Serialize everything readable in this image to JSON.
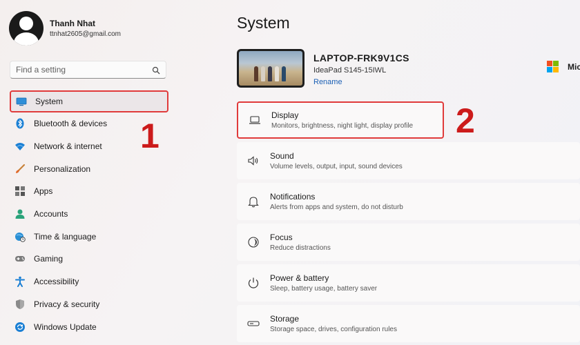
{
  "profile": {
    "name": "Thanh Nhat",
    "email": "ttnhat2605@gmail.com"
  },
  "search": {
    "placeholder": "Find a setting",
    "icon": "search-icon"
  },
  "sidebar": {
    "items": [
      {
        "label": "System",
        "icon": "system-icon",
        "active": true
      },
      {
        "label": "Bluetooth & devices",
        "icon": "bluetooth-icon"
      },
      {
        "label": "Network & internet",
        "icon": "wifi-icon"
      },
      {
        "label": "Personalization",
        "icon": "brush-icon"
      },
      {
        "label": "Apps",
        "icon": "apps-icon"
      },
      {
        "label": "Accounts",
        "icon": "accounts-icon"
      },
      {
        "label": "Time & language",
        "icon": "globe-clock-icon"
      },
      {
        "label": "Gaming",
        "icon": "gamepad-icon"
      },
      {
        "label": "Accessibility",
        "icon": "accessibility-icon"
      },
      {
        "label": "Privacy & security",
        "icon": "shield-icon"
      },
      {
        "label": "Windows Update",
        "icon": "update-icon"
      }
    ]
  },
  "annotations": {
    "step1": "1",
    "step2": "2",
    "color": "#cc1b1b"
  },
  "main": {
    "title": "System",
    "device": {
      "name": "LAPTOP-FRK9V1CS",
      "model": "IdeaPad S145-15IWL",
      "rename_label": "Rename"
    },
    "microsoft_label": "Mic",
    "cards": [
      {
        "title": "Display",
        "subtitle": "Monitors, brightness, night light, display profile",
        "icon": "laptop-icon"
      },
      {
        "title": "Sound",
        "subtitle": "Volume levels, output, input, sound devices",
        "icon": "speaker-icon"
      },
      {
        "title": "Notifications",
        "subtitle": "Alerts from apps and system, do not disturb",
        "icon": "bell-icon"
      },
      {
        "title": "Focus",
        "subtitle": "Reduce distractions",
        "icon": "focus-icon"
      },
      {
        "title": "Power & battery",
        "subtitle": "Sleep, battery usage, battery saver",
        "icon": "power-icon"
      },
      {
        "title": "Storage",
        "subtitle": "Storage space, drives, configuration rules",
        "icon": "storage-icon"
      }
    ]
  },
  "colors": {
    "accent": "#0067c0",
    "highlight_border": "#e03a3a"
  }
}
